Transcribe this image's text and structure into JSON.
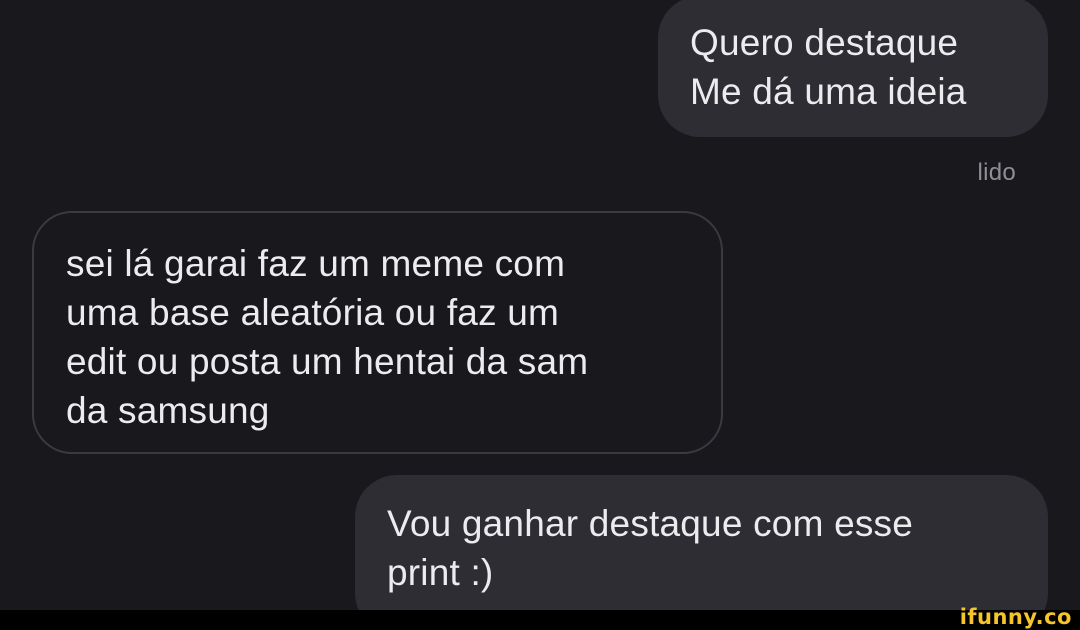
{
  "messages": [
    {
      "direction": "outgoing",
      "text": "Quero destaque\nMe dá uma ideia"
    },
    {
      "direction": "incoming",
      "text": "sei lá garai faz um meme com\numa base aleatória ou faz um\nedit ou posta um hentai da sam\nda samsung"
    },
    {
      "direction": "outgoing",
      "text": "Vou ganhar destaque com esse\nprint :)"
    }
  ],
  "read_receipt": "lido",
  "watermark": "ifunny.co",
  "colors": {
    "background": "#18181d",
    "outgoing_bubble": "#2d2d33",
    "incoming_border": "#3a3a41",
    "text": "#ececee",
    "receipt": "#8e8e94",
    "watermark": "#f6c42b"
  }
}
